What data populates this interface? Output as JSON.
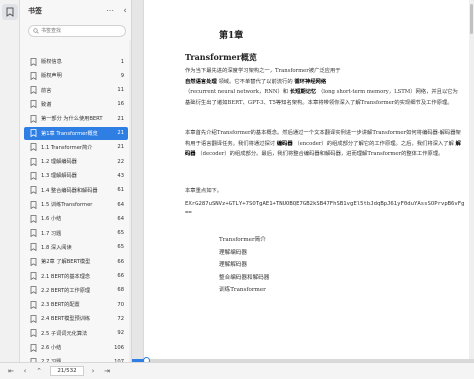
{
  "sidebar": {
    "title": "书签",
    "search_placeholder": "书签查找",
    "items": [
      {
        "label": "版权信息",
        "page": "1"
      },
      {
        "label": "版权声明",
        "page": "9"
      },
      {
        "label": "前言",
        "page": "11"
      },
      {
        "label": "致谢",
        "page": "16"
      },
      {
        "label": "第一部分 为什么使用BERT",
        "page": "21"
      },
      {
        "label": "第1章 Transformer概览",
        "page": "21"
      },
      {
        "label": "1.1 Transformer简介",
        "page": "21"
      },
      {
        "label": "1.2 理解编码器",
        "page": "22"
      },
      {
        "label": "1.3 理解解码器",
        "page": "43"
      },
      {
        "label": "1.4 整合编码器和解码器",
        "page": "61"
      },
      {
        "label": "1.5 训练Transformer",
        "page": "64"
      },
      {
        "label": "1.6 小结",
        "page": "64"
      },
      {
        "label": "1.7 习题",
        "page": "65"
      },
      {
        "label": "1.8 深入阅读",
        "page": "65"
      },
      {
        "label": "第2章 了解BERT模型",
        "page": "66"
      },
      {
        "label": "2.1 BERT的基本理念",
        "page": "66"
      },
      {
        "label": "2.2 BERT的工作原理",
        "page": "68"
      },
      {
        "label": "2.3 BERT的配置",
        "page": "70"
      },
      {
        "label": "2.4 BERT模型预训练",
        "page": "72"
      },
      {
        "label": "2.5 子词词元化算法",
        "page": "92"
      },
      {
        "label": "2.6 小结",
        "page": "106"
      },
      {
        "label": "2.7 习题",
        "page": "107"
      }
    ],
    "active_index": 5
  },
  "document": {
    "chapter": "第1章",
    "section_title": "Transformer概览",
    "para1_a": "作为当下最先进的深度学习架构之一，Transformer被广泛应用于",
    "para1_b1": "自然语言处理",
    "para1_c": "领域。它不单替代了以前流行的",
    "para1_d": "循环神经网络",
    "para1_e": "（recurrent neural network，RNN）和",
    "para1_f": "长短期记忆",
    "para1_g": "（long short-term memory，LSTM）网络，并且以它为基础衍生出了诸如BERT、GPT-3、T5等知名架构。本章将带领你深入了解Transformer的实现细节及工作原理。",
    "para2_a": "本章首先介绍Transformer的基本概念。然后通过一个文本翻译实例进一步讲解Transformer如何将编码器-解码器架构用于语言翻译任务。我们将通过探讨",
    "para2_b": "编码器",
    "para2_c": "（encoder）的组成部分了解它的工作原理。之后，我们将深入了解",
    "para2_d": "解码器",
    "para2_e": "（decoder）的组成部分。最后，我们将整合编码器和解码器，进而理解Transformer的整体工作原理。",
    "para3": "本章重点如下。",
    "url_text": "EXrG287uSNVz+GTLY+7SOTgAE1+TNUOBQE7GB2kSB47FhSB1vgEl5tbJdqBpJ61yF0duYAssSOPrvpB6vFg==",
    "toc": [
      "Transformer简介",
      "理解编码器",
      "理解解码器",
      "整合编码器和解码器",
      "训练Transformer"
    ]
  },
  "bottombar": {
    "page_indicator": "21/532"
  },
  "progress": {
    "fraction": 0.04
  }
}
